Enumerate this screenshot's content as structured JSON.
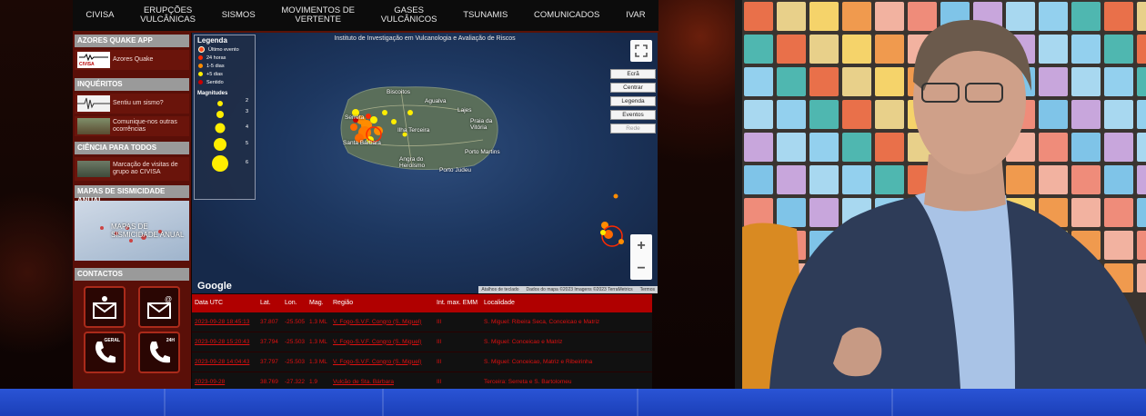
{
  "nav": {
    "items": [
      "CIVISA",
      "ERUPÇÕES\nVULCÂNICAS",
      "SISMOS",
      "MOVIMENTOS DE\nVERTENTE",
      "GASES\nVULCÂNICOS",
      "TSUNAMIS",
      "COMUNICADOS",
      "IVAR"
    ]
  },
  "sidebar": {
    "quake_app_title": "AZORES QUAKE APP",
    "quake_app_thumb_label": "CIVISA",
    "quake_app_link": "Azores Quake",
    "inqueritos_title": "INQUÉRITOS",
    "inqueritos_link1": "Sentiu um sismo?",
    "inqueritos_link2": "Comunique-nos outras ocorrências",
    "ciencia_title": "CIÊNCIA PARA TODOS",
    "ciencia_link": "Marcação de visitas de grupo ao CIVISA",
    "mapas_title": "MAPAS DE SISMICIDADE ANUAL",
    "mapas_thumb_label": "MAPAS DE SISMICIDADE ANUAL",
    "contactos_title": "CONTACTOS",
    "phone_general_tag": "GERAL",
    "phone_24h_tag": "24H"
  },
  "map": {
    "title": "Instituto de Investigação em Vulcanologia e Avaliação de Riscos",
    "legend": {
      "title": "Legenda",
      "items": [
        {
          "label": "Último evento",
          "color": "#ff4a1a"
        },
        {
          "label": "24 horas",
          "color": "#ff2a00"
        },
        {
          "label": "1-5 dias",
          "color": "#ff8c00"
        },
        {
          "label": "+5 dias",
          "color": "#ffee00"
        },
        {
          "label": "Sentido",
          "color": "#cc0000"
        }
      ],
      "magnitudes_title": "Magnitudes",
      "magnitudes": [
        "2",
        "3",
        "4",
        "5",
        "6"
      ]
    },
    "controls": {
      "screen": "Ecrã",
      "center": "Centrar",
      "legend": "Legenda",
      "events": "Eventos",
      "network": "Rede"
    },
    "zoom_in": "+",
    "zoom_out": "−",
    "google": "Google",
    "attribution": {
      "shortcuts": "Atalhos de teclado",
      "data": "Dados do mapa ©2023 Imagens ©2023 TerraMetrics",
      "terms": "Termos"
    },
    "places": {
      "biscoitos": "Biscoitos",
      "agualva": "Agualva",
      "lajes": "Lajes",
      "serreta": "Serreta",
      "ilha": "Ilha Terceira",
      "praia": "Praia da Vitória",
      "santa_barbara": "Santa Bárbara",
      "porto_martins": "Porto Martins",
      "angra": "Angra do Heroísmo",
      "porto_judeu": "Porto Judeu"
    }
  },
  "table": {
    "headers": [
      "Data UTC",
      "Lat.",
      "Lon.",
      "Mag.",
      "Região",
      "Int. max. EMM",
      "Localidade"
    ],
    "rows": [
      [
        "2023-09-28 18:45:13",
        "37.807",
        "-25.505",
        "1.3 ML",
        "V. Fogo-S.V.F. Congro (S. Miguel)",
        "III",
        "S. Miguel: Ribeira Seca, Conceicao e Matriz"
      ],
      [
        "2023-09-28 15:20:43",
        "37.794",
        "-25.503",
        "1.3 ML",
        "V. Fogo-S.V.F. Congro (S. Miguel)",
        "III",
        "S. Miguel: Conceicao e Matriz"
      ],
      [
        "2023-09-28 14:04:43",
        "37.797",
        "-25.503",
        "1.3 ML",
        "V. Fogo-S.V.F. Congro (S. Miguel)",
        "III",
        "S. Miguel: Conceicao, Matriz e Ribeirinha"
      ],
      [
        "2023-09-28",
        "38.769",
        "-27.322",
        "1.9",
        "Vulcão de Sta. Bárbara",
        "III",
        "Terceira: Serreta e S. Bartolomeu"
      ]
    ]
  }
}
